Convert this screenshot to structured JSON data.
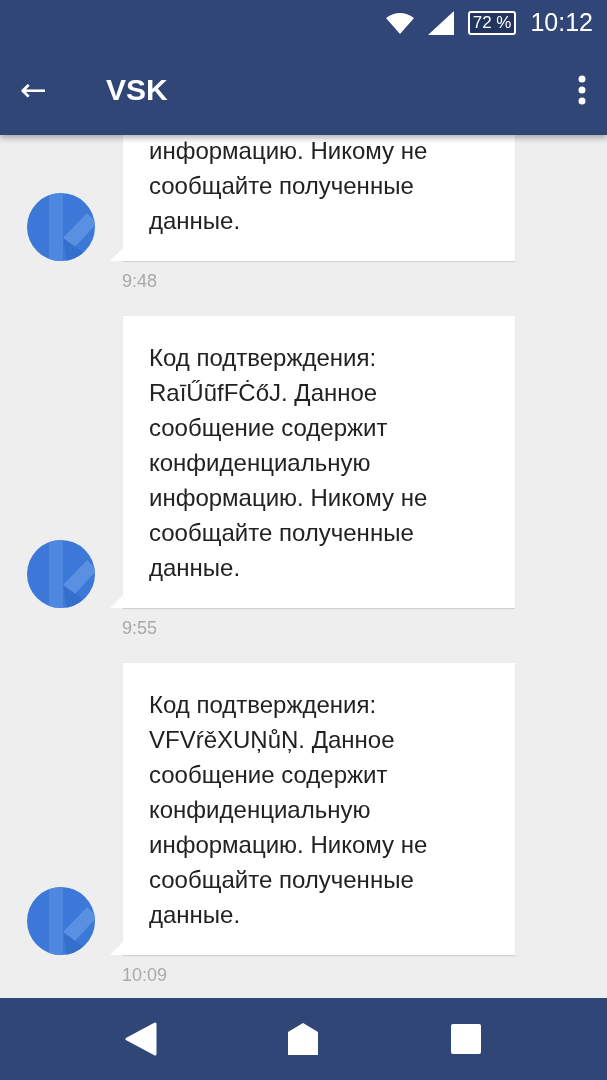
{
  "status_bar": {
    "battery": "72 %",
    "time": "10:12"
  },
  "app_bar": {
    "back": "←",
    "title": "VSK"
  },
  "messages": [
    {
      "text": "информацию. Никому не сообщайте полученные данные.",
      "time": "9:48"
    },
    {
      "text": "Код подтверждения: RaīŰũfFĊőJ. Данное сообщение содержит конфиденциальную информацию. Никому не сообщайте полученные данные.",
      "time": "9:55"
    },
    {
      "text": "Код подтверждения: VFVŕěXUŅůŅ. Данное сообщение содержит конфиденциальную информацию. Никому не сообщайте полученные данные.",
      "time": "10:09"
    }
  ]
}
